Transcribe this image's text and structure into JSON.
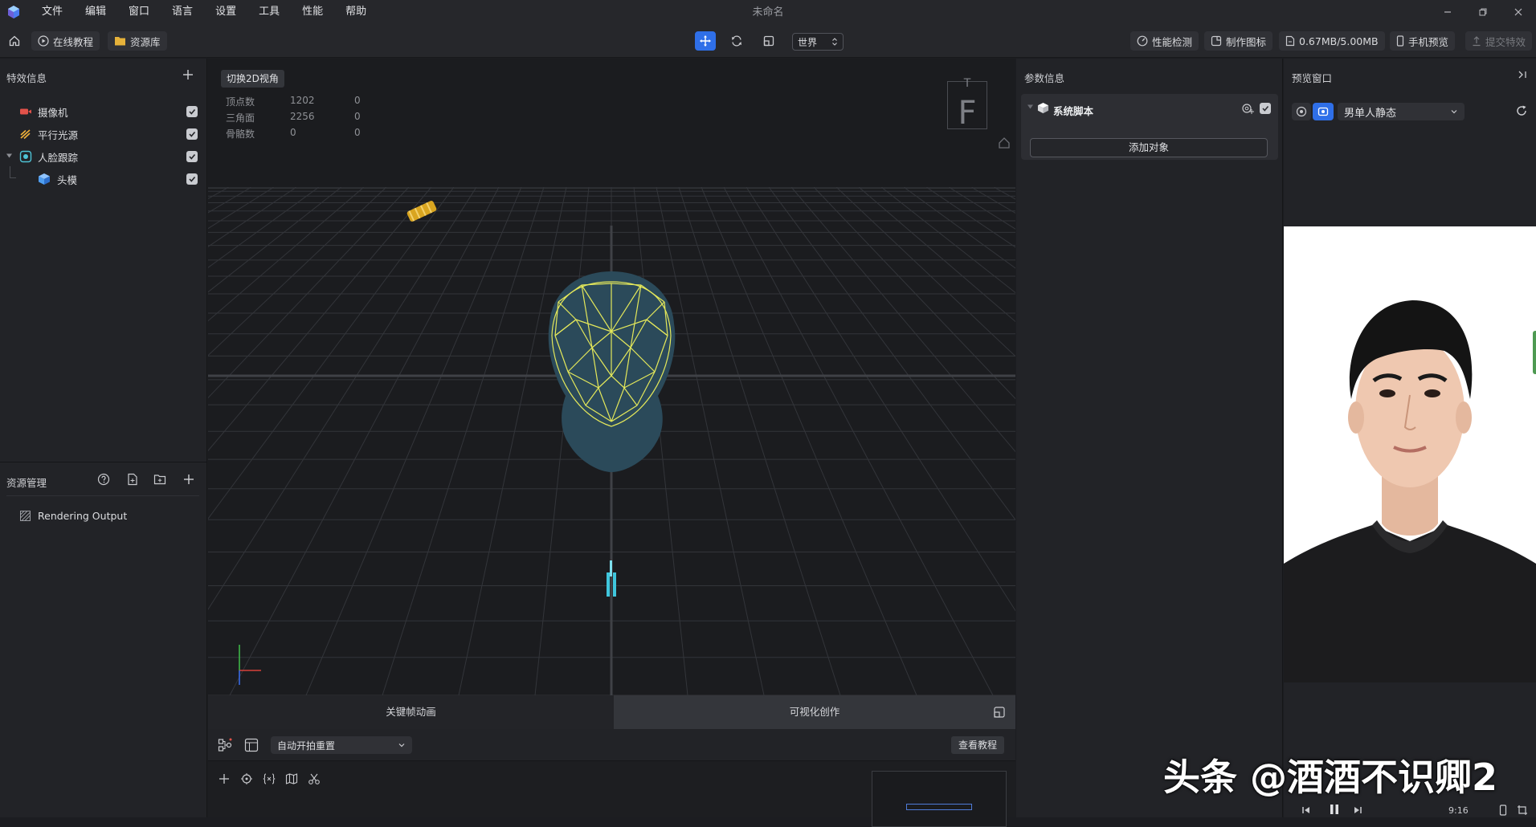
{
  "window": {
    "title": "未命名"
  },
  "menu": [
    "文件",
    "编辑",
    "窗口",
    "语言",
    "设置",
    "工具",
    "性能",
    "帮助"
  ],
  "toolbar": {
    "tutorial_label": "在线教程",
    "library_label": "资源库",
    "space_select": "世界",
    "perf_check": "性能检测",
    "make_icon": "制作图标",
    "size_usage": "0.67MB/5.00MB",
    "phone_preview": "手机预览",
    "submit_effect": "提交特效"
  },
  "effects_panel": {
    "title": "特效信息",
    "items": [
      {
        "label": "摄像机",
        "icon": "camera-icon",
        "color": "#e2524a",
        "checked": true
      },
      {
        "label": "平行光源",
        "icon": "light-icon",
        "color": "#f0b23a",
        "checked": true
      },
      {
        "label": "人脸跟踪",
        "icon": "face-track-icon",
        "color": "#4ec3d6",
        "checked": true
      },
      {
        "label": "头模",
        "icon": "cube-icon",
        "color": "#4f9ef0",
        "checked": true
      }
    ]
  },
  "resource_panel": {
    "title": "资源管理",
    "items": [
      {
        "label": "Rendering Output",
        "icon": "render-output-icon"
      }
    ]
  },
  "viewport": {
    "switch_2d": "切换2D视角",
    "stats": [
      {
        "label": "顶点数",
        "v1": "1202",
        "v2": "0"
      },
      {
        "label": "三角面",
        "v1": "2256",
        "v2": "0"
      },
      {
        "label": "骨骼数",
        "v1": "0",
        "v2": "0"
      }
    ],
    "gizmo_top": "T",
    "gizmo_front": "F"
  },
  "timeline": {
    "tab_keyframe": "关键帧动画",
    "tab_visual": "可视化创作",
    "auto_select": "自动开拍重置",
    "tutorial_btn": "查看教程"
  },
  "params_panel": {
    "title": "参数信息",
    "script_title": "系统脚本",
    "add_object": "添加对象"
  },
  "preview_panel": {
    "title": "预览窗口",
    "model_select": "男单人静态",
    "ratio": "9:16"
  },
  "watermark": "头条 @酒酒不识卿2",
  "colors": {
    "accent": "#2f6fe8",
    "wireframe": "#e4e85a",
    "head": "#2b4a5a"
  }
}
